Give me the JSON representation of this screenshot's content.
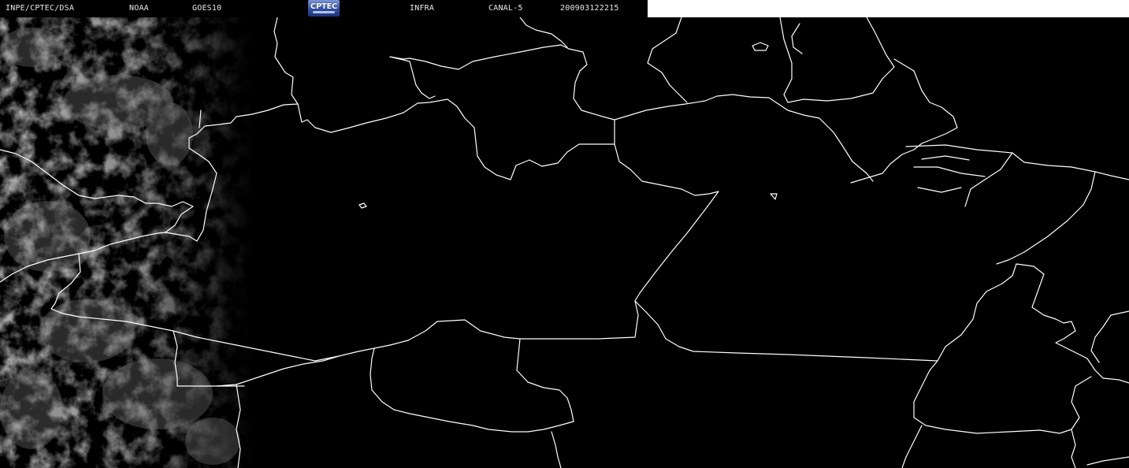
{
  "header": {
    "institution": "INPE/CPTEC/DSA",
    "agency": "NOAA",
    "satellite": "GOES10",
    "logo": "CPTEC",
    "image_type": "INFRA",
    "channel": "CANAL-5",
    "timestamp": "200903122215"
  },
  "colors": {
    "background": "#000000",
    "borders": "#ffffff",
    "cloud_tone": "#6e6e6e",
    "header_text": "#e8e8e8"
  }
}
